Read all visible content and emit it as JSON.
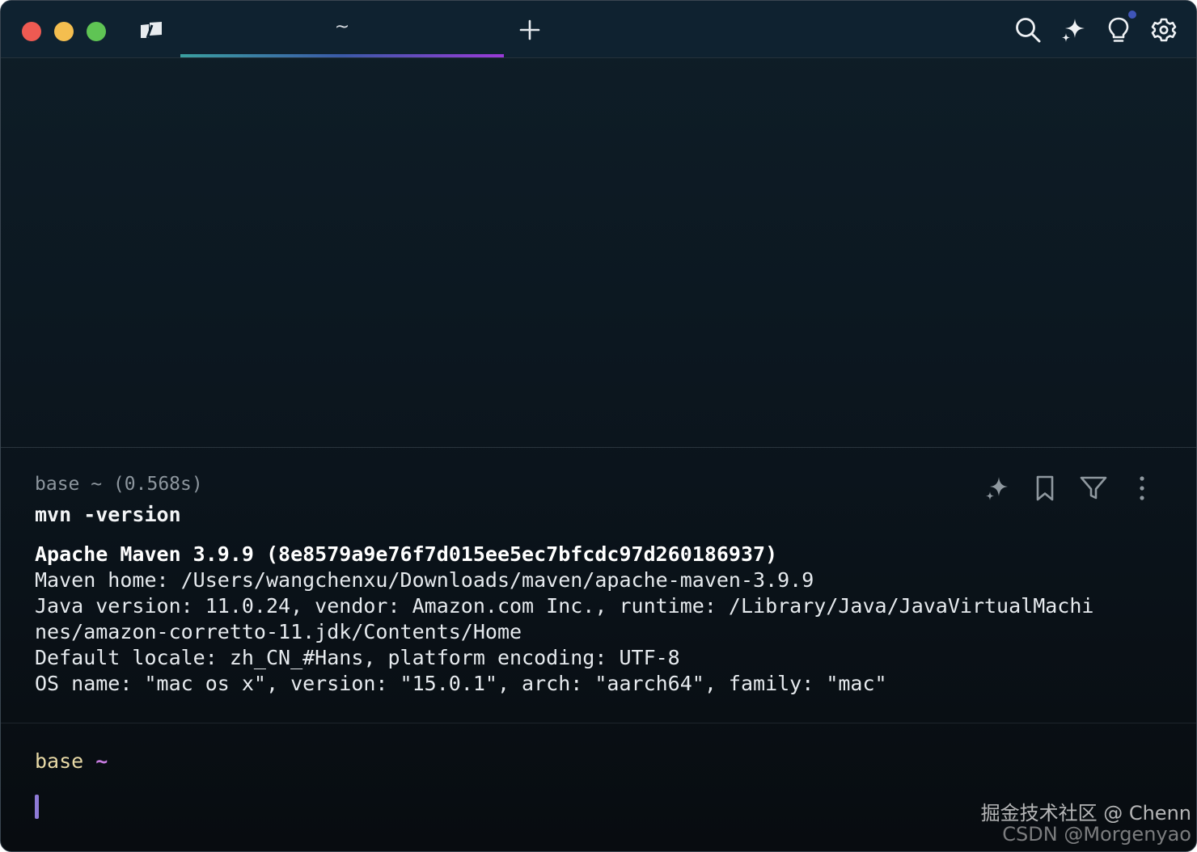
{
  "window": {
    "traffic_colors": {
      "close": "#ee5a52",
      "minimize": "#f4be4f",
      "zoom": "#5fc454"
    }
  },
  "tabs": [
    {
      "title": "~",
      "active": true
    }
  ],
  "toolbar_icons": [
    "search-icon",
    "ai-sparkle-icon",
    "lightbulb-icon",
    "gear-icon"
  ],
  "block": {
    "env": "base",
    "dir": "~",
    "duration": "(0.568s)",
    "meta_text": "base ~ (0.568s)",
    "command": "mvn -version",
    "output": [
      "Apache Maven 3.9.9 (8e8579a9e76f7d015ee5ec7bfcdc97d260186937)",
      "Maven home: /Users/wangchenxu/Downloads/maven/apache-maven-3.9.9",
      "Java version: 11.0.24, vendor: Amazon.com Inc., runtime: /Library/Java/JavaVirtualMachi",
      "nes/amazon-corretto-11.jdk/Contents/Home",
      "Default locale: zh_CN_#Hans, platform encoding: UTF-8",
      "OS name: \"mac os x\", version: \"15.0.1\", arch: \"aarch64\", family: \"mac\""
    ],
    "action_icons": [
      "ai-sparkle-icon",
      "bookmark-icon",
      "filter-icon",
      "more-vertical-icon"
    ]
  },
  "prompt": {
    "env": "base",
    "dir": "~"
  },
  "colors": {
    "tab_gradient": [
      "#3aa0a0",
      "#3a5aa8",
      "#9a3ad8"
    ],
    "prompt_env": "#e8d9a6",
    "prompt_dir": "#c77ce0",
    "cursor": "#8e7ad6"
  },
  "watermark": {
    "line1": "掘金技术社区 @ Chenn",
    "line2": "CSDN @Morgenyao"
  }
}
